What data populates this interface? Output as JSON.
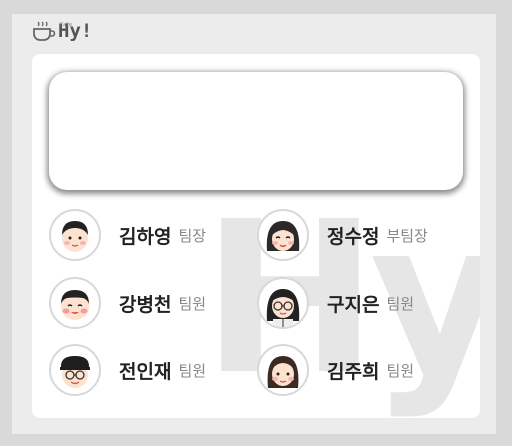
{
  "header": {
    "brand": "Hy!",
    "brand_small": "Cafe"
  },
  "members": [
    {
      "name": "김하영",
      "role": "팀장"
    },
    {
      "name": "정수정",
      "role": "부팀장"
    },
    {
      "name": "강병천",
      "role": "팀원"
    },
    {
      "name": "구지은",
      "role": "팀원"
    },
    {
      "name": "전인재",
      "role": "팀원"
    },
    {
      "name": "김주희",
      "role": "팀원"
    }
  ],
  "watermark": "Hy"
}
